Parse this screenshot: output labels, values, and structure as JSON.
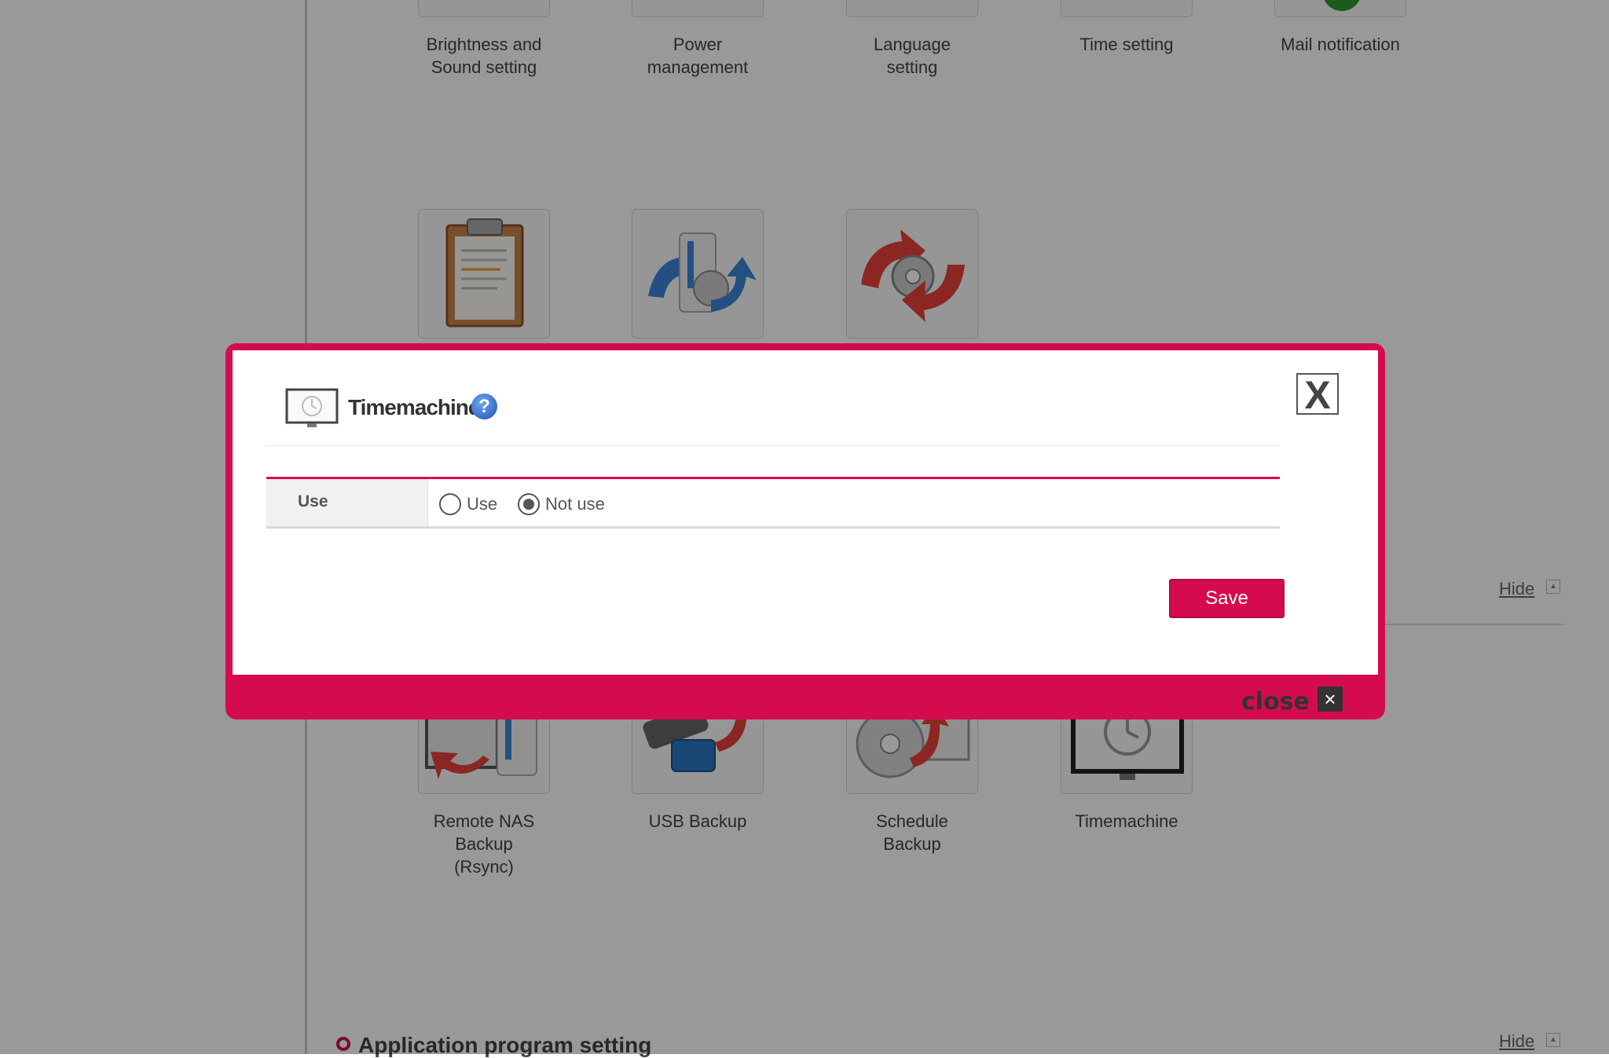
{
  "background": {
    "top_tiles": [
      {
        "label": "Brightness and\nSound setting"
      },
      {
        "label": "Power\nmanagement"
      },
      {
        "label": "Language\nsetting"
      },
      {
        "label": "Time setting"
      },
      {
        "label": "Mail notification"
      }
    ],
    "backup_tiles": [
      {
        "label": "Remote NAS\nBackup\n(Rsync)"
      },
      {
        "label": "USB Backup"
      },
      {
        "label": "Schedule\nBackup"
      },
      {
        "label": "Timemachine"
      }
    ],
    "hide_label": "Hide",
    "section_title": "Application program setting"
  },
  "modal": {
    "title": "Timemachine",
    "help_icon": "?",
    "close_x": "X",
    "field_label": "Use",
    "radio_use": "Use",
    "radio_not_use": "Not use",
    "selected": "Not use",
    "save_label": "Save",
    "footer_close_label": "close",
    "footer_close_icon": "×"
  },
  "colors": {
    "accent": "#d40c4d",
    "overlay": "rgba(0,0,0,0.40)"
  }
}
